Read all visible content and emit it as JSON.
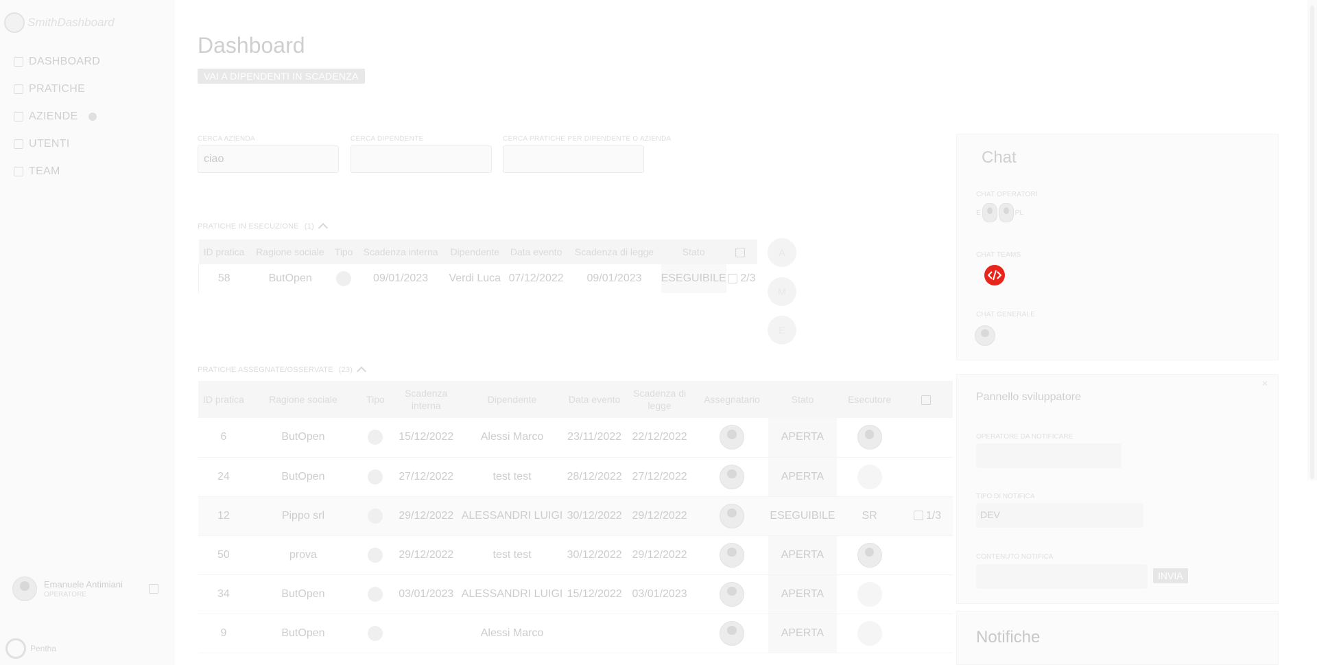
{
  "sidebar": {
    "brand": "SmithDashboard",
    "items": [
      {
        "label": "DASHBOARD",
        "icon": "dashboard-icon"
      },
      {
        "label": "PRATICHE",
        "icon": "folder-icon"
      },
      {
        "label": "AZIENDE",
        "icon": "building-icon"
      },
      {
        "label": "UTENTI",
        "icon": "user-icon"
      },
      {
        "label": "TEAM",
        "icon": "team-icon"
      }
    ],
    "user": {
      "name": "Emanuele Antimiani",
      "role": "OPERATORE"
    },
    "footer_brand": "Pentha"
  },
  "header": {
    "title": "Dashboard",
    "deadline_button": "VAI A DIPENDENTI IN SCADENZA"
  },
  "search": {
    "company_label": "CERCA AZIENDA",
    "company_value": "ciao",
    "employee_label": "CERCA DIPENDENTE",
    "practice_label": "CERCA PRATICHE PER DIPENDENTE O AZIENDA"
  },
  "in_progress": {
    "title": "PRATICHE IN ESECUZIONE",
    "count": "(1)",
    "columns": [
      "ID pratica",
      "Ragione sociale",
      "Tipo",
      "Scadenza interna",
      "Dipendente",
      "Data evento",
      "Scadenza di legge",
      "Stato"
    ],
    "rows": [
      {
        "id": "58",
        "company": "ButOpen",
        "due_internal": "09/01/2023",
        "employee": "Verdi Luca",
        "event_date": "07/12/2022",
        "due_legal": "09/01/2023",
        "status": "ESEGUIBILE",
        "progress": "2/3"
      }
    ],
    "side_buttons": [
      "A",
      "M",
      "E"
    ]
  },
  "assigned": {
    "title": "PRATICHE ASSEGNATE/OSSERVATE",
    "count": "(23)",
    "columns": [
      "ID pratica",
      "Ragione sociale",
      "Tipo",
      "Scadenza interna",
      "Dipendente",
      "Data evento",
      "Scadenza di legge",
      "Assegnatario",
      "Stato",
      "Esecutore"
    ],
    "rows": [
      {
        "id": "6",
        "company": "ButOpen",
        "due_internal": "15/12/2022",
        "employee": "Alessi Marco",
        "event_date": "23/11/2022",
        "due_legal": "22/12/2022",
        "status": "APERTA",
        "executor": "",
        "progress": ""
      },
      {
        "id": "24",
        "company": "ButOpen",
        "due_internal": "27/12/2022",
        "employee": "test test",
        "event_date": "28/12/2022",
        "due_legal": "27/12/2022",
        "status": "APERTA",
        "executor": "",
        "progress": ""
      },
      {
        "id": "12",
        "company": "Pippo srl",
        "due_internal": "29/12/2022",
        "employee": "ALESSANDRI LUIGI",
        "event_date": "30/12/2022",
        "due_legal": "29/12/2022",
        "status": "ESEGUIBILE",
        "executor": "SR",
        "progress": "1/3"
      },
      {
        "id": "50",
        "company": "prova",
        "due_internal": "29/12/2022",
        "employee": "test test",
        "event_date": "30/12/2022",
        "due_legal": "29/12/2022",
        "status": "APERTA",
        "executor": "",
        "progress": ""
      },
      {
        "id": "34",
        "company": "ButOpen",
        "due_internal": "03/01/2023",
        "employee": "ALESSANDRI LUIGI",
        "event_date": "15/12/2022",
        "due_legal": "03/01/2023",
        "status": "APERTA",
        "executor": "",
        "progress": ""
      },
      {
        "id": "9",
        "company": "ButOpen",
        "due_internal": "",
        "employee": "Alessi Marco",
        "event_date": "",
        "due_legal": "",
        "status": "APERTA",
        "executor": "",
        "progress": ""
      }
    ]
  },
  "chat": {
    "title": "Chat",
    "operators_label": "CHAT OPERATORI",
    "operator_initials": [
      "E",
      "PL"
    ],
    "teams_label": "CHAT TEAMS",
    "team_icon": "code-team-icon",
    "team_icon_color": "#e8251b",
    "general_label": "CHAT GENERALE"
  },
  "dev_panel": {
    "title": "Pannello sviluppatore",
    "operator_label": "OPERATORE DA NOTIFICARE",
    "type_label": "TIPO DI NOTIFICA",
    "type_value": "DEV",
    "content_label": "CONTENUTO NOTIFICA",
    "send_button": "INVIA"
  },
  "notifications": {
    "title": "Notifiche"
  }
}
